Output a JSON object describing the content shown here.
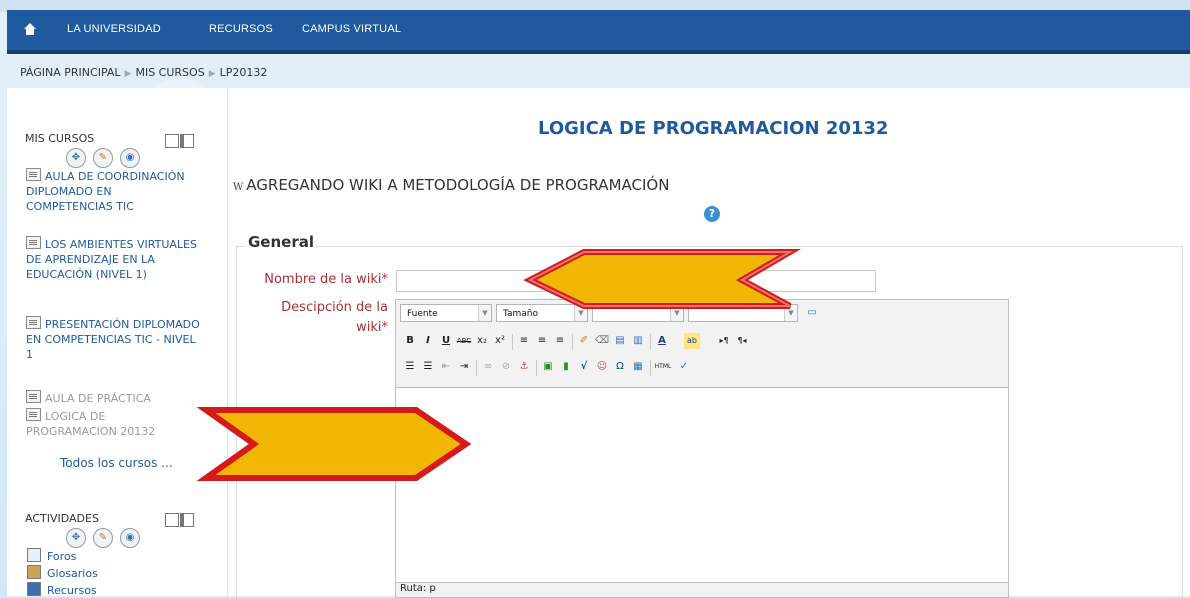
{
  "nav": {
    "home_icon": "home-icon",
    "links": [
      "LA UNIVERSIDAD",
      "RECURSOS",
      "CAMPUS VIRTUAL"
    ]
  },
  "breadcrumb": [
    "PÁGINA PRINCIPAL",
    "MIS CURSOS",
    "LP20132"
  ],
  "sidebar": {
    "my_courses": {
      "title": "MIS CURSOS",
      "items": [
        {
          "label": "AULA DE COORDINACIÓN DIPLOMADO EN COMPETENCIAS TIC",
          "dim": false
        },
        {
          "label": "LOS AMBIENTES VIRTUALES DE APRENDIZAJE EN LA EDUCACIÓN (NIVEL 1)",
          "dim": false
        },
        {
          "label": "PRESENTACIÓN DIPLOMADO EN COMPETENCIAS TIC - NIVEL 1",
          "dim": false
        },
        {
          "label": "AULA DE PRÁCTICA",
          "dim": true
        },
        {
          "label": "LOGICA DE PROGRAMACION 20132",
          "dim": true
        }
      ],
      "all_courses": "Todos los cursos ..."
    },
    "activities": {
      "title": "ACTIVIDADES",
      "items": [
        "Foros",
        "Glosarios",
        "Recursos"
      ]
    }
  },
  "main": {
    "page_title": "LOGICA DE PROGRAMACION 20132",
    "section_icon_letter": "W",
    "section_heading": "AGREGANDO WIKI A METODOLOGÍA DE PROGRAMACIÓN",
    "help_icon": "?",
    "fieldset_legend": "General",
    "fields": {
      "name_label_line1": "Nombre de la wiki",
      "desc_label_line1": "Descipción de la",
      "desc_label_line2": "wiki",
      "required_mark": "*",
      "name_value": ""
    },
    "editor": {
      "font_select": "Fuente",
      "size_select": "Tamaño",
      "path_text": "Ruta: p"
    }
  },
  "colors": {
    "nav_bg": "#1f5a9f",
    "link": "#1f5a9f",
    "required": "#cc2222",
    "arrow_fill": "#f2b705",
    "arrow_stroke": "#d61a1a"
  }
}
